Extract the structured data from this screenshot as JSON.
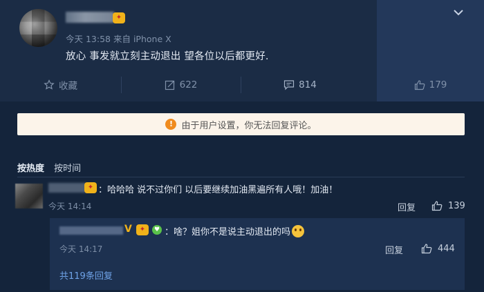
{
  "post": {
    "meta": "今天 13:58 来自 iPhone X",
    "text": "放心 事发就立刻主动退出 望各位以后都更好.",
    "badge_glyph": "✦"
  },
  "actions": {
    "favorite": "收藏",
    "repost_count": "622",
    "comment_count": "814",
    "like_count": "179"
  },
  "notice": {
    "icon_glyph": "!",
    "text": "由于用户设置，你无法回复评论。"
  },
  "sort": {
    "hot": "按热度",
    "time": "按时间"
  },
  "comment": {
    "text": "：哈哈哈 说不过你们 以后要继续加油黑遍所有人哦！加油！",
    "time": "今天 14:14",
    "reply_label": "回复",
    "like_count": "139"
  },
  "sub_reply": {
    "v_badge": "V",
    "text": "：啥？姐你不是说主动退出的吗",
    "time": "今天 14:17",
    "reply_label": "回复",
    "like_count": "444",
    "more_replies": "共119条回复"
  },
  "colors": {
    "background": "#14243b",
    "post_bg": "#1b2c45",
    "notice_bg": "#fcf4ea",
    "warn": "#f08b1e",
    "link": "#6fa3e8"
  }
}
